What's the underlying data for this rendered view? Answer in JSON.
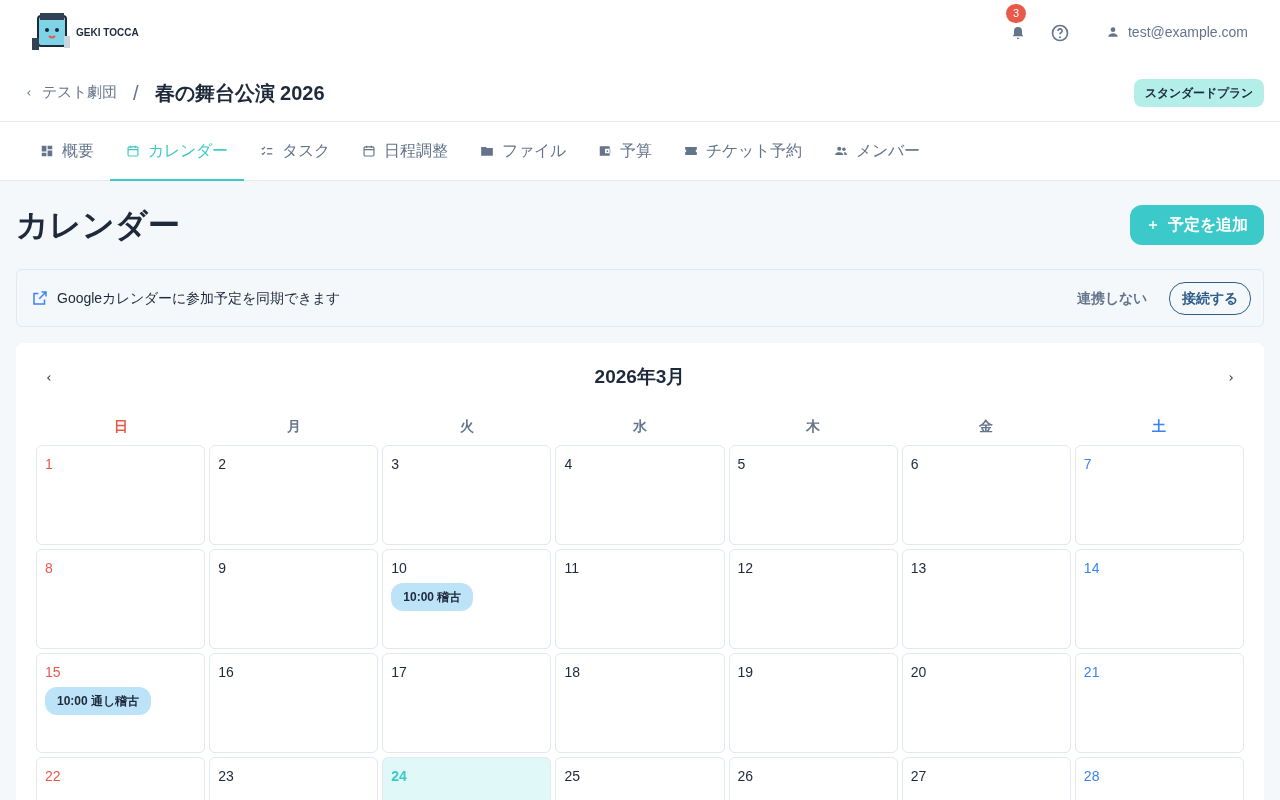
{
  "header": {
    "logo_text": "GEKI TOCCA",
    "notifications": {
      "count": "3"
    },
    "user": {
      "email": "test@example.com"
    }
  },
  "breadcrumb": {
    "parent": "テスト劇団",
    "separator": "/",
    "title": "春の舞台公演 2026",
    "plan_badge": "スタンダードプラン"
  },
  "tabs": [
    {
      "label": "概要",
      "selected": false
    },
    {
      "label": "カレンダー",
      "selected": true
    },
    {
      "label": "タスク",
      "selected": false
    },
    {
      "label": "日程調整",
      "selected": false
    },
    {
      "label": "ファイル",
      "selected": false
    },
    {
      "label": "予算",
      "selected": false
    },
    {
      "label": "チケット予約",
      "selected": false
    },
    {
      "label": "メンバー",
      "selected": false
    }
  ],
  "page": {
    "title": "カレンダー",
    "add_button": "予定を追加"
  },
  "sync_banner": {
    "message": "Googleカレンダーに参加予定を同期できます",
    "skip_button": "連携しない",
    "connect_button": "接続する"
  },
  "calendar": {
    "month": "2026年3月",
    "weekdays": [
      "日",
      "月",
      "火",
      "水",
      "木",
      "金",
      "土"
    ],
    "weeks": [
      [
        {
          "day": "1",
          "today": false
        },
        {
          "day": "2",
          "today": false
        },
        {
          "day": "3",
          "today": false
        },
        {
          "day": "4",
          "today": false
        },
        {
          "day": "5",
          "today": false
        },
        {
          "day": "6",
          "today": false
        },
        {
          "day": "7",
          "today": false
        }
      ],
      [
        {
          "day": "8",
          "today": false
        },
        {
          "day": "9",
          "today": false
        },
        {
          "day": "10",
          "today": false,
          "events": [
            "10:00 稽古"
          ]
        },
        {
          "day": "11",
          "today": false
        },
        {
          "day": "12",
          "today": false
        },
        {
          "day": "13",
          "today": false
        },
        {
          "day": "14",
          "today": false
        }
      ],
      [
        {
          "day": "15",
          "today": false,
          "events": [
            "10:00 通し稽古"
          ]
        },
        {
          "day": "16",
          "today": false
        },
        {
          "day": "17",
          "today": false
        },
        {
          "day": "18",
          "today": false
        },
        {
          "day": "19",
          "today": false
        },
        {
          "day": "20",
          "today": false
        },
        {
          "day": "21",
          "today": false
        }
      ],
      [
        {
          "day": "22",
          "today": false
        },
        {
          "day": "23",
          "today": false
        },
        {
          "day": "24",
          "today": true
        },
        {
          "day": "25",
          "today": false
        },
        {
          "day": "26",
          "today": false
        },
        {
          "day": "27",
          "today": false
        },
        {
          "day": "28",
          "today": false
        }
      ]
    ]
  }
}
